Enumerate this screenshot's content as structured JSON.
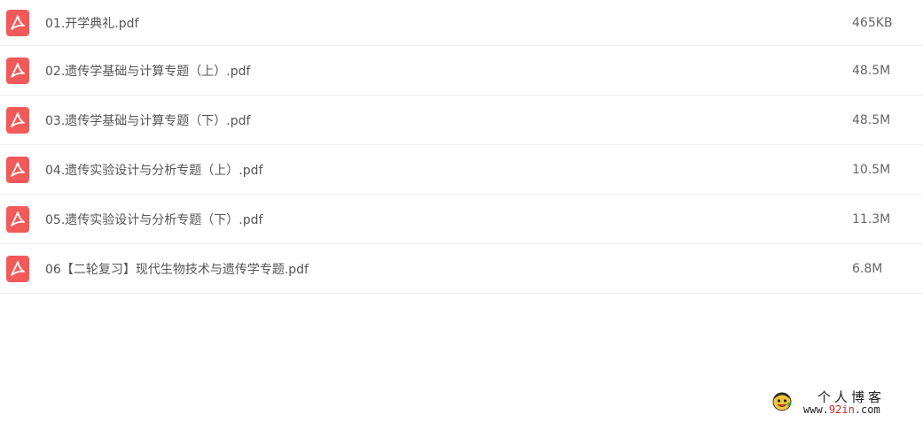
{
  "files": [
    {
      "icon": "pdf-icon",
      "name": "01.开学典礼.pdf",
      "size": "465KB"
    },
    {
      "icon": "pdf-icon",
      "name": "02.遗传学基础与计算专题（上）.pdf",
      "size": "48.5M"
    },
    {
      "icon": "pdf-icon",
      "name": "03.遗传学基础与计算专题（下）.pdf",
      "size": "48.5M"
    },
    {
      "icon": "pdf-icon",
      "name": "04.遗传实验设计与分析专题（上）.pdf",
      "size": "10.5M"
    },
    {
      "icon": "pdf-icon",
      "name": "05.遗传实验设计与分析专题（下）.pdf",
      "size": "11.3M"
    },
    {
      "icon": "pdf-icon",
      "name": "06【二轮复习】现代生物技术与遗传学专题.pdf",
      "size": "6.8M"
    }
  ],
  "watermark": {
    "title": "个人博客",
    "url_prefix": "www.",
    "url_accent": "92in",
    "url_suffix": ".com"
  },
  "colors": {
    "pdf_icon": "#f25a5a",
    "row_divider": "#eeeeee",
    "watermark_accent": "#d22a2a"
  }
}
